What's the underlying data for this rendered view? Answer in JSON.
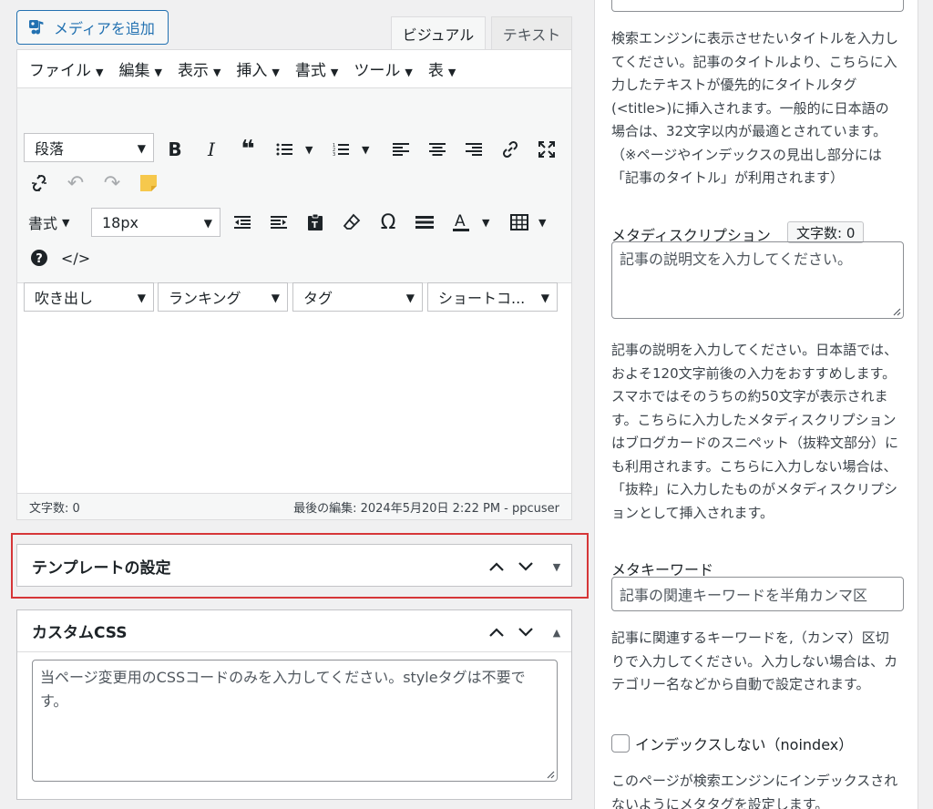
{
  "editor": {
    "media_button": "メディアを追加",
    "tabs": {
      "visual": "ビジュアル",
      "text": "テキスト"
    },
    "menu": [
      "ファイル",
      "編集",
      "表示",
      "挿入",
      "書式",
      "ツール",
      "表"
    ],
    "selects": {
      "paragraph": "段落",
      "format": "書式",
      "font_size": "18px",
      "balloon": "吹き出し",
      "ranking": "ランキング",
      "tag": "タグ",
      "shortcode": "ショートコ..."
    },
    "status_word_count": "文字数: 0",
    "status_last_edit": "最後の編集: 2024年5月20日 2:22 PM - ppcuser"
  },
  "template_box": {
    "title": "テンプレートの設定"
  },
  "css_box": {
    "title": "カスタムCSS",
    "placeholder": "当ページ変更用のCSSコードのみを入力してください。styleタグは不要です。"
  },
  "sidebar": {
    "title_desc": "検索エンジンに表示させたいタイトルを入力してください。記事のタイトルより、こちらに入力したテキストが優先的にタイトルタグ(<title>)に挿入されます。一般的に日本語の場合は、32文字以内が最適とされています。（※ページやインデックスの見出し部分には「記事のタイトル」が利用されます）",
    "meta_desc_label": "メタディスクリプション",
    "meta_desc_count": "文字数: 0",
    "meta_desc_placeholder": "記事の説明文を入力してください。",
    "meta_desc_help": "記事の説明を入力してください。日本語では、およそ120文字前後の入力をおすすめします。スマホではそのうちの約50文字が表示されます。こちらに入力したメタディスクリプションはブログカードのスニペット（抜粋文部分）にも利用されます。こちらに入力しない場合は、「抜粋」に入力したものがメタディスクリプションとして挿入されます。",
    "keyword_label": "メタキーワード",
    "keyword_placeholder": "記事の関連キーワードを半角カンマ区",
    "keyword_help": "記事に関連するキーワードを,（カンマ）区切りで入力してください。入力しない場合は、カテゴリー名などから自動で設定されます。",
    "noindex_label": "インデックスしない（noindex）",
    "noindex_help": "このページが検索エンジンにインデックスされないようにメタタグを設定します。"
  }
}
